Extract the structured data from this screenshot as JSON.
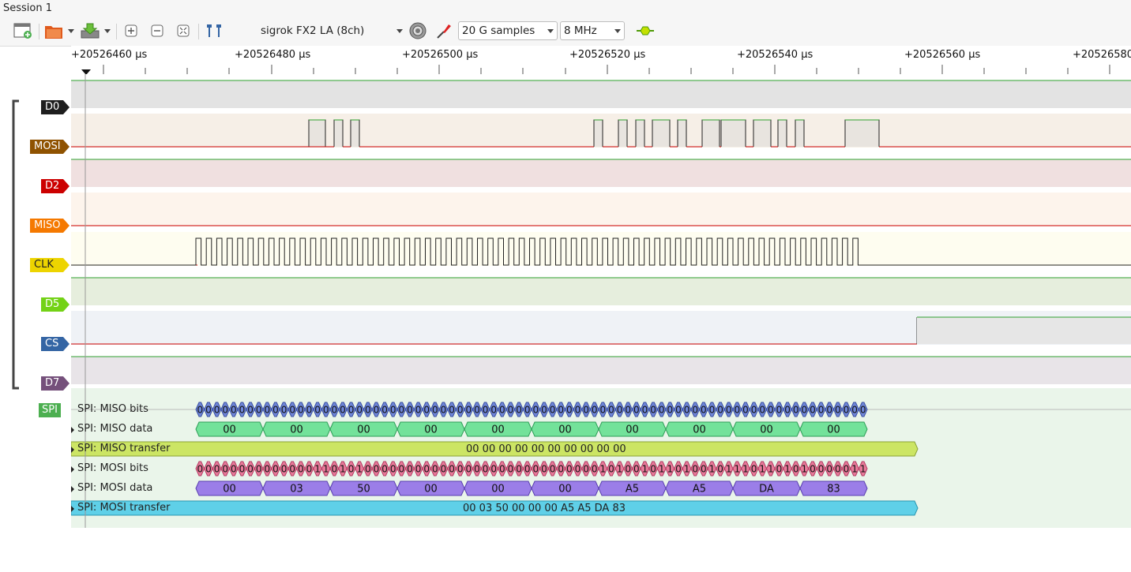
{
  "window": {
    "title": "Session 1"
  },
  "toolbar": {
    "device": "sigrok FX2 LA (8ch)",
    "samples": "20 G samples",
    "samplerate": "8 MHz",
    "icons": [
      "new-view-icon",
      "open-file-icon",
      "save-icon",
      "zoom-in-icon",
      "zoom-out-icon",
      "zoom-fit-icon",
      "cursor-icon",
      "configure-device-icon",
      "probe-icon",
      "run-icon"
    ]
  },
  "ruler": {
    "ticks": [
      "+20526460 µs",
      "+20526480 µs",
      "+20526500 µs",
      "+20526520 µs",
      "+20526540 µs",
      "+20526560 µs",
      "+20526580 µs"
    ]
  },
  "channels": [
    {
      "name": "D0",
      "color": "#1e1e1e"
    },
    {
      "name": "MOSI",
      "color": "#8f5200"
    },
    {
      "name": "D2",
      "color": "#cc0000"
    },
    {
      "name": "MISO",
      "color": "#f57900"
    },
    {
      "name": "CLK",
      "color": "#edd400"
    },
    {
      "name": "D5",
      "color": "#73d216"
    },
    {
      "name": "CS",
      "color": "#3465a4"
    },
    {
      "name": "D7",
      "color": "#75507b"
    }
  ],
  "decoder": {
    "name": "SPI",
    "color": "#4caf50",
    "rows": [
      {
        "label": "SPI: MISO bits",
        "annotation_values": "0"
      },
      {
        "label": "SPI: MISO data",
        "values": [
          "00",
          "00",
          "00",
          "00",
          "00",
          "00",
          "00",
          "00",
          "00",
          "00"
        ]
      },
      {
        "label": "SPI: MISO transfer",
        "value": "00 00 00 00 00 00 00 00 00 00"
      },
      {
        "label": "SPI: MOSI bits",
        "bits": "00000000000000110101000000000000000000000000000010100101101001011101101010000011"
      },
      {
        "label": "SPI: MOSI data",
        "values": [
          "00",
          "03",
          "50",
          "00",
          "00",
          "00",
          "A5",
          "A5",
          "DA",
          "83"
        ]
      },
      {
        "label": "SPI: MOSI transfer",
        "value": "00 03 50 00 00 00 A5 A5 DA 83"
      }
    ]
  }
}
